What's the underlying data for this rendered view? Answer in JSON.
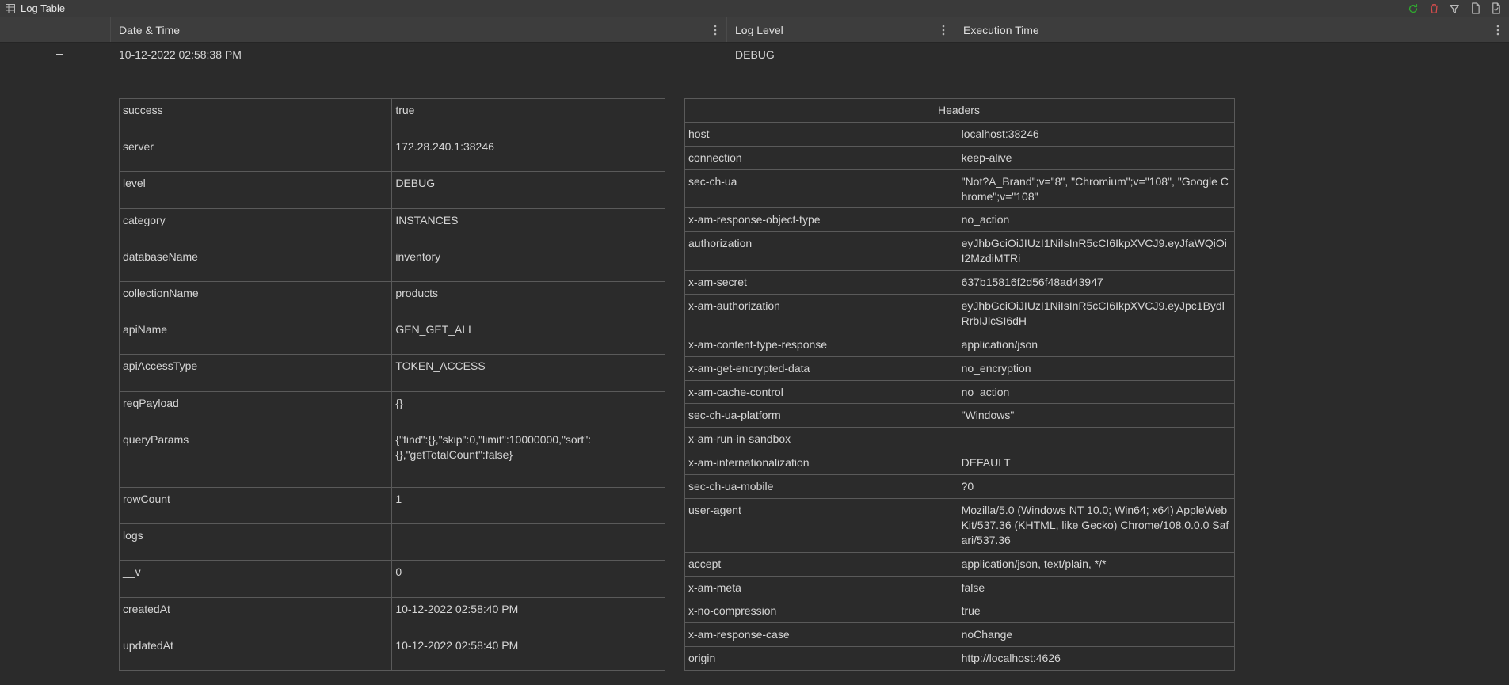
{
  "titlebar": {
    "title": "Log Table"
  },
  "columns": {
    "datetime": "Date & Time",
    "loglevel": "Log Level",
    "exectime": "Execution Time"
  },
  "row": {
    "datetime": "10-12-2022 02:58:38 PM",
    "loglevel": "DEBUG",
    "exectime": ""
  },
  "detail_left": [
    {
      "k": "success",
      "v": "true"
    },
    {
      "k": "server",
      "v": "172.28.240.1:38246"
    },
    {
      "k": "level",
      "v": "DEBUG"
    },
    {
      "k": "category",
      "v": "INSTANCES"
    },
    {
      "k": "databaseName",
      "v": "inventory"
    },
    {
      "k": "collectionName",
      "v": "products"
    },
    {
      "k": "apiName",
      "v": "GEN_GET_ALL"
    },
    {
      "k": "apiAccessType",
      "v": "TOKEN_ACCESS"
    },
    {
      "k": "reqPayload",
      "v": "{}"
    },
    {
      "k": "queryParams",
      "v": "{\"find\":{},\"skip\":0,\"limit\":10000000,\"sort\":{},\"getTotalCount\":false}"
    },
    {
      "k": "rowCount",
      "v": "1"
    },
    {
      "k": "logs",
      "v": ""
    },
    {
      "k": "__v",
      "v": "0"
    },
    {
      "k": "createdAt",
      "v": "10-12-2022 02:58:40 PM"
    },
    {
      "k": "updatedAt",
      "v": "10-12-2022 02:58:40 PM"
    }
  ],
  "detail_right_header": "Headers",
  "detail_right": [
    {
      "k": "host",
      "v": "localhost:38246"
    },
    {
      "k": "connection",
      "v": "keep-alive"
    },
    {
      "k": "sec-ch-ua",
      "v": "\"Not?A_Brand\";v=\"8\", \"Chromium\";v=\"108\", \"Google Chrome\";v=\"108\""
    },
    {
      "k": "x-am-response-object-type",
      "v": "no_action"
    },
    {
      "k": "authorization",
      "v": "eyJhbGciOiJIUzI1NiIsInR5cCI6IkpXVCJ9.eyJfaWQiOiI2MzdiMTRi"
    },
    {
      "k": "x-am-secret",
      "v": "637b15816f2d56f48ad43947"
    },
    {
      "k": "x-am-authorization",
      "v": "eyJhbGciOiJIUzI1NiIsInR5cCI6IkpXVCJ9.eyJpc1BydlRrbIJlcSI6dH"
    },
    {
      "k": "x-am-content-type-response",
      "v": "application/json"
    },
    {
      "k": "x-am-get-encrypted-data",
      "v": "no_encryption"
    },
    {
      "k": "x-am-cache-control",
      "v": "no_action"
    },
    {
      "k": "sec-ch-ua-platform",
      "v": "\"Windows\""
    },
    {
      "k": "x-am-run-in-sandbox",
      "v": ""
    },
    {
      "k": "x-am-internationalization",
      "v": "DEFAULT"
    },
    {
      "k": "sec-ch-ua-mobile",
      "v": "?0"
    },
    {
      "k": "user-agent",
      "v": "Mozilla/5.0 (Windows NT 10.0; Win64; x64) AppleWebKit/537.36 (KHTML, like Gecko) Chrome/108.0.0.0 Safari/537.36"
    },
    {
      "k": "accept",
      "v": "application/json, text/plain, */*"
    },
    {
      "k": "x-am-meta",
      "v": "false"
    },
    {
      "k": "x-no-compression",
      "v": "true"
    },
    {
      "k": "x-am-response-case",
      "v": "noChange"
    },
    {
      "k": "origin",
      "v": "http://localhost:4626"
    }
  ],
  "icons": {
    "refresh": "refresh-icon",
    "delete": "delete-icon",
    "filter": "filter-icon",
    "export1": "export-icon",
    "export2": "copy-icon"
  }
}
